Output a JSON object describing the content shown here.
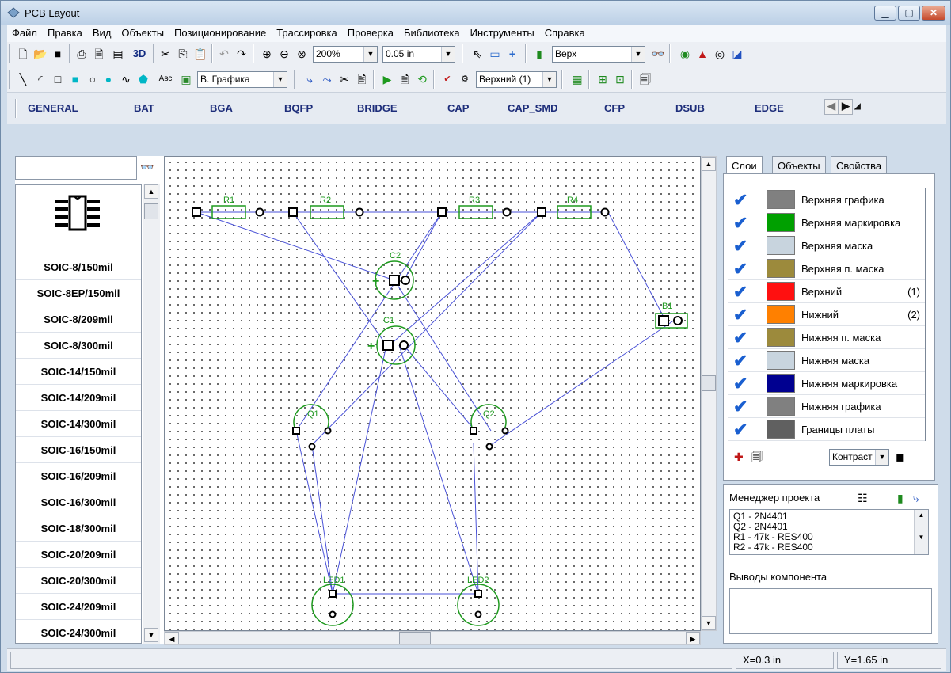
{
  "window": {
    "title": "PCB Layout"
  },
  "menu": [
    "Файл",
    "Правка",
    "Вид",
    "Объекты",
    "Позиционирование",
    "Трассировка",
    "Проверка",
    "Библиотека",
    "Инструменты",
    "Справка"
  ],
  "toolbar1": {
    "zoom": "200%",
    "grid": "0.05 in",
    "layer": "Верх",
    "label_3d": "3D"
  },
  "toolbar2": {
    "text_tool": "Авс",
    "graphics_layer": "В. Графика",
    "signal_layer": "Верхний (1)"
  },
  "library_tabs": [
    "GENERAL",
    "BAT",
    "BGA",
    "BQFP",
    "BRIDGE",
    "CAP",
    "CAP_SMD",
    "CFP",
    "DSUB",
    "EDGE"
  ],
  "search": {
    "value": ""
  },
  "components": [
    "SOIC-8/150mil",
    "SOIC-8EP/150mil",
    "SOIC-8/209mil",
    "SOIC-8/300mil",
    "SOIC-14/150mil",
    "SOIC-14/209mil",
    "SOIC-14/300mil",
    "SOIC-16/150mil",
    "SOIC-16/209mil",
    "SOIC-16/300mil",
    "SOIC-18/300mil",
    "SOIC-20/209mil",
    "SOIC-20/300mil",
    "SOIC-24/209mil",
    "SOIC-24/300mil"
  ],
  "pcb_labels": {
    "r1": "R1",
    "r2": "R2",
    "r3": "R3",
    "r4": "R4",
    "c1": "C1",
    "c2": "C2",
    "b1": "B1",
    "q1": "Q1",
    "q2": "Q2",
    "led1": "LED1",
    "led2": "LED2",
    "plus": "+"
  },
  "panel_tabs": [
    "Слои",
    "Объекты",
    "Свойства"
  ],
  "layers": [
    {
      "name": "Верхняя графика",
      "color": "#808080",
      "num": ""
    },
    {
      "name": "Верхняя маркировка",
      "color": "#00a000",
      "num": ""
    },
    {
      "name": "Верхняя маска",
      "color": "#c8d4de",
      "num": ""
    },
    {
      "name": "Верхняя п. маска",
      "color": "#9c8a3c",
      "num": ""
    },
    {
      "name": "Верхний",
      "color": "#ff1010",
      "num": "(1)"
    },
    {
      "name": "Нижний",
      "color": "#ff8000",
      "num": "(2)"
    },
    {
      "name": "Нижняя п. маска",
      "color": "#9c8a3c",
      "num": ""
    },
    {
      "name": "Нижняя маска",
      "color": "#c8d4de",
      "num": ""
    },
    {
      "name": "Нижняя маркировка",
      "color": "#000090",
      "num": ""
    },
    {
      "name": "Нижняя графика",
      "color": "#808080",
      "num": ""
    },
    {
      "name": "Границы платы",
      "color": "#606060",
      "num": ""
    }
  ],
  "contrast": "Контраст",
  "project_manager": {
    "title": "Менеджер проекта",
    "items": [
      "Q1 - 2N4401",
      "Q2 - 2N4401",
      "R1 - 47k - RES400",
      "R2 - 47k - RES400"
    ]
  },
  "component_pins": {
    "title": "Выводы компонента"
  },
  "status": {
    "x": "X=0.3 in",
    "y": "Y=1.65 in"
  }
}
